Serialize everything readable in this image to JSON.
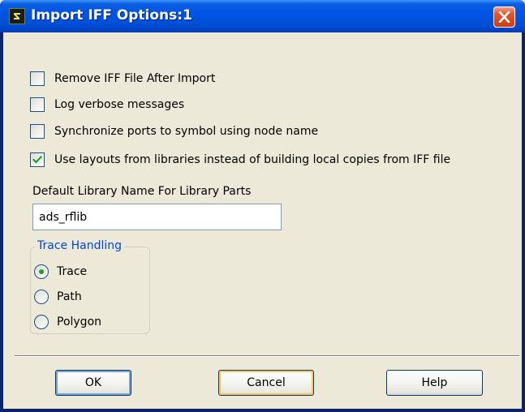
{
  "window": {
    "title": "Import IFF Options:1"
  },
  "options": [
    {
      "label": "Remove IFF File After Import",
      "checked": false
    },
    {
      "label": "Log verbose messages",
      "checked": false
    },
    {
      "label": "Synchronize ports to symbol using node name",
      "checked": false
    },
    {
      "label": "Use layouts from libraries instead of building local copies from IFF file",
      "checked": true
    }
  ],
  "library": {
    "label": "Default Library Name For Library Parts",
    "value": "ads_rflib"
  },
  "trace_handling": {
    "legend": "Trace Handling",
    "options": [
      {
        "label": "Trace",
        "selected": true
      },
      {
        "label": "Path",
        "selected": false
      },
      {
        "label": "Polygon",
        "selected": false
      }
    ]
  },
  "buttons": {
    "ok": "OK",
    "cancel": "Cancel",
    "help": "Help"
  },
  "colors": {
    "titlebar": "#0054e3",
    "check_mark": "#21a121",
    "legend_text": "#0046d5",
    "dialog_bg": "#ece9d8"
  }
}
